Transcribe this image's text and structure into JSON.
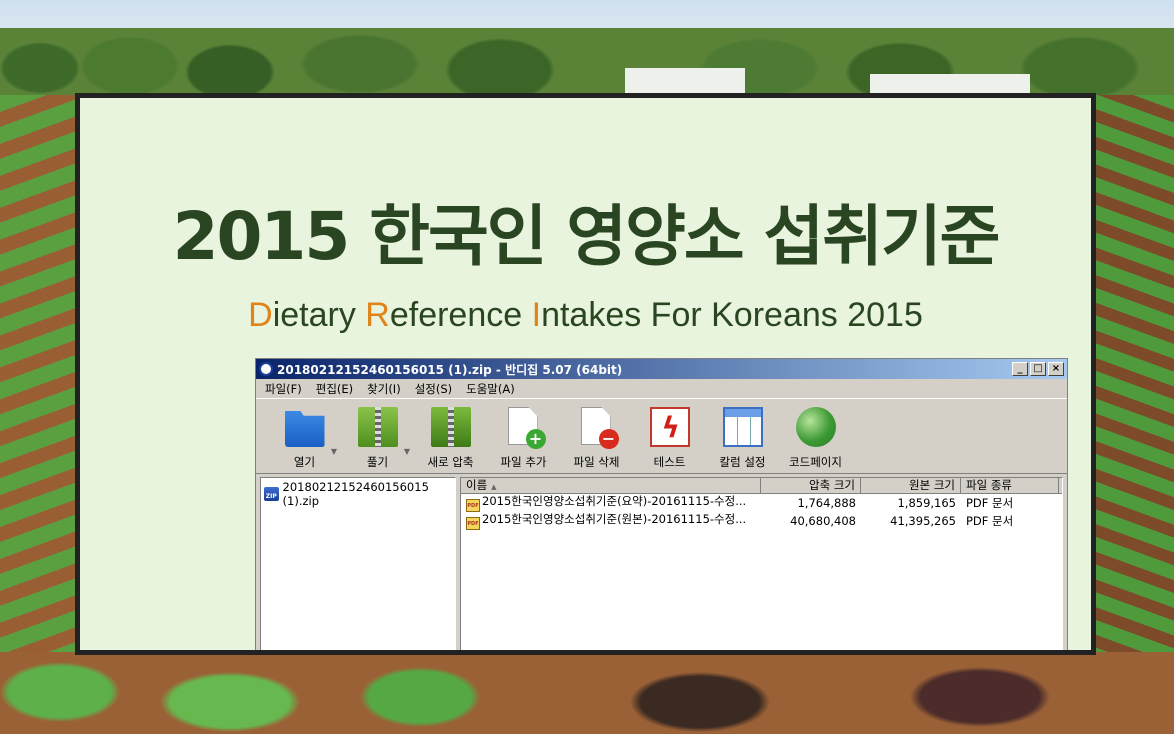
{
  "title": "2015 한국인 영양소 섭취기준",
  "subtitle": {
    "d": "D",
    "d_rest": "ietary ",
    "r": "R",
    "r_rest": "eference ",
    "i": "I",
    "i_rest": "ntakes For Koreans 2015"
  },
  "colors": {
    "title": "#2a4521",
    "highlight": "#e08419",
    "panel_bg": "#e8f4dd"
  },
  "window": {
    "title": "20180212152460156015 (1).zip - 반디집 5.07 (64bit)",
    "buttons": {
      "minimize": "_",
      "maximize": "□",
      "close": "×"
    }
  },
  "menu": [
    "파일(F)",
    "편집(E)",
    "찾기(I)",
    "설정(S)",
    "도움말(A)"
  ],
  "toolbar": [
    {
      "label": "열기",
      "icon": "folder-open-icon"
    },
    {
      "label": "풀기",
      "icon": "extract-icon"
    },
    {
      "label": "새로 압축",
      "icon": "new-archive-icon"
    },
    {
      "label": "파일 추가",
      "icon": "add-file-icon"
    },
    {
      "label": "파일 삭제",
      "icon": "delete-file-icon"
    },
    {
      "label": "테스트",
      "icon": "test-icon"
    },
    {
      "label": "칼럼 설정",
      "icon": "columns-icon"
    },
    {
      "label": "코드페이지",
      "icon": "globe-icon"
    }
  ],
  "tree": {
    "root": "20180212152460156015 (1).zip"
  },
  "list": {
    "headers": {
      "name": "이름",
      "compressed": "압축 크기",
      "original": "원본 크기",
      "type": "파일 종류"
    },
    "rows": [
      {
        "name": "2015한국인영양소섭취기준(요약)-20161115-수정...",
        "compressed": "1,764,888",
        "original": "1,859,165",
        "type": "PDF 문서"
      },
      {
        "name": "2015한국인영양소섭취기준(원본)-20161115-수정...",
        "compressed": "40,680,408",
        "original": "41,395,265",
        "type": "PDF 문서"
      }
    ]
  }
}
